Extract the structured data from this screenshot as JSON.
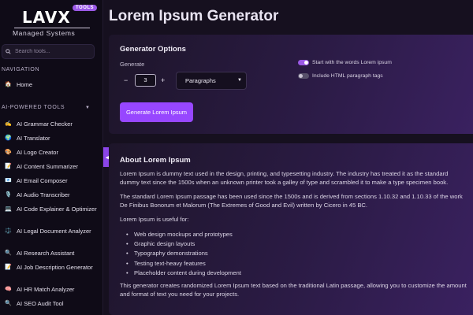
{
  "brand": {
    "logo_word": "LAVX",
    "badge": "TOOLS",
    "subtitle": "Managed Systems"
  },
  "sidebar": {
    "search_placeholder": "Search tools...",
    "nav_heading": "NAVIGATION",
    "home": {
      "icon": "home-icon",
      "label": "Home"
    },
    "ai_heading": "AI-POWERED TOOLS",
    "tools": [
      {
        "icon": "pencil-icon",
        "label": "AI Grammar Checker"
      },
      {
        "icon": "globe-icon",
        "label": "AI Translator"
      },
      {
        "icon": "palette-icon",
        "label": "AI Logo Creator"
      },
      {
        "icon": "memo-icon",
        "label": "AI Content Summarizer"
      },
      {
        "icon": "envelope-icon",
        "label": "AI Email Composer"
      },
      {
        "icon": "microphone-icon",
        "label": "AI Audio Transcriber"
      },
      {
        "icon": "laptop-icon",
        "label": "AI Code Explainer & Optimizer"
      },
      {
        "icon": "scales-icon",
        "label": "AI Legal Document Analyzer"
      },
      {
        "icon": "magnifier-icon",
        "label": "AI Research Assistant"
      },
      {
        "icon": "notepad-icon",
        "label": "AI Job Description Generator"
      },
      {
        "icon": "brain-icon",
        "label": "AI HR Match Analyzer"
      },
      {
        "icon": "magnifier-icon",
        "label": "AI SEO Audit Tool"
      }
    ]
  },
  "main": {
    "title": "Lorem Ipsum Generator",
    "options": {
      "heading": "Generator Options",
      "generate_label": "Generate",
      "minus": "−",
      "plus": "+",
      "count": "3",
      "unit_selected": "Paragraphs",
      "button": "Generate Lorem Ipsum",
      "toggle_start": {
        "label": "Start with the words Lorem ipsum",
        "on": true
      },
      "toggle_html": {
        "label": "Include HTML paragraph tags",
        "on": false
      }
    },
    "about": {
      "heading": "About Lorem Ipsum",
      "p1": "Lorem Ipsum is dummy text used in the design, printing, and typesetting industry. The industry has treated it as the standard dummy text since the 1500s when an unknown printer took a galley of type and scrambled it to make a type specimen book.",
      "p2": "The standard Lorem Ipsum passage has been used since the 1500s and is derived from sections 1.10.32 and 1.10.33 of the work De Finibus Bonorum et Malorum (The Extremes of Good and Evil) written by Cicero in 45 BC.",
      "p3": "Lorem Ipsum is useful for:",
      "uses": [
        "Web design mockups and prototypes",
        "Graphic design layouts",
        "Typography demonstrations",
        "Testing text-heavy features",
        "Placeholder content during development"
      ],
      "p4": "This generator creates randomized Lorem Ipsum text based on the traditional Latin passage, allowing you to customize the amount and format of text you need for your projects."
    }
  },
  "colors": {
    "accent": "#9747ff",
    "sidebar_bg": "#0f0b17",
    "page_bg": "#16101f"
  }
}
